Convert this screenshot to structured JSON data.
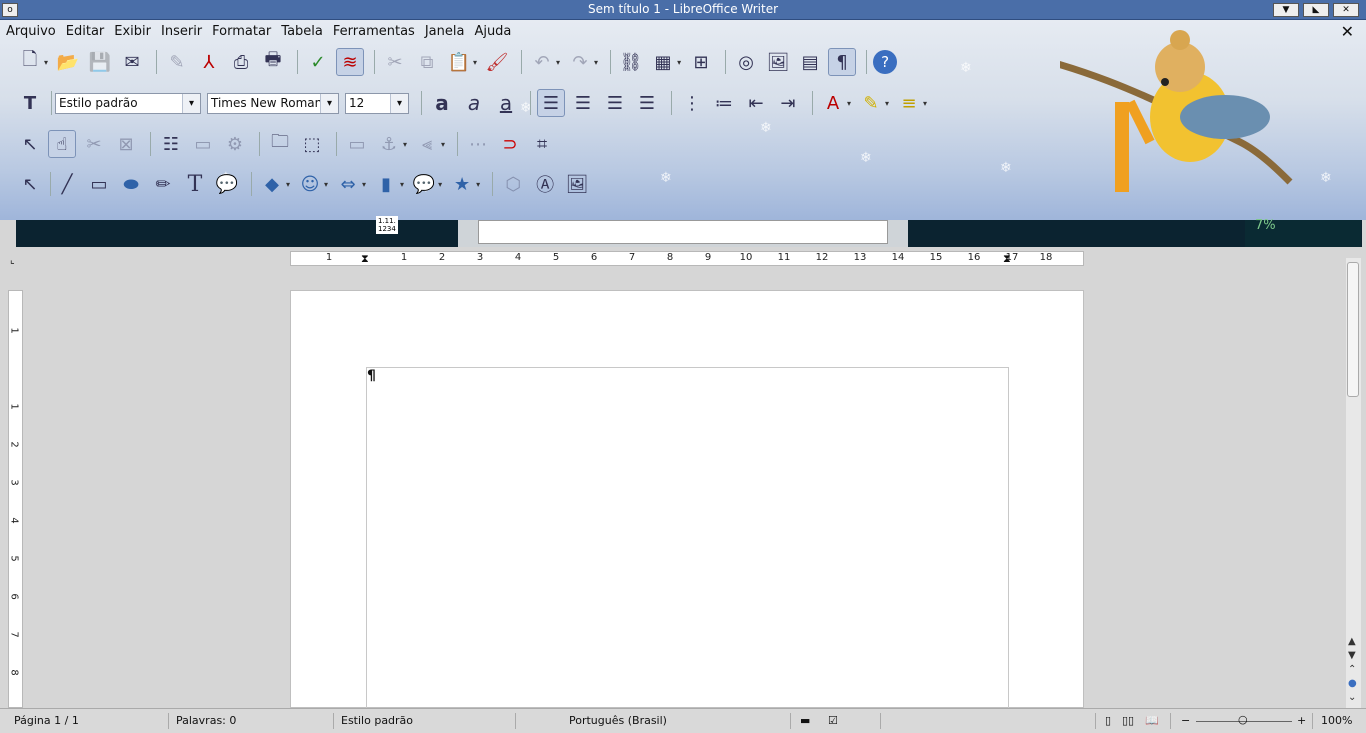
{
  "window": {
    "title": "Sem título 1 - LibreOffice Writer"
  },
  "menu": [
    "Arquivo",
    "Editar",
    "Exibir",
    "Inserir",
    "Formatar",
    "Tabela",
    "Ferramentas",
    "Janela",
    "Ajuda"
  ],
  "formatting": {
    "paragraph_style": "Estilo padrão",
    "font_name": "Times New Roman",
    "font_size": "12"
  },
  "ruler": {
    "h_ticks": [
      "1",
      "1",
      "2",
      "3",
      "4",
      "5",
      "6",
      "7",
      "8",
      "9",
      "10",
      "11",
      "12",
      "13",
      "14",
      "15",
      "16",
      "17",
      "18"
    ],
    "v_ticks": [
      "1",
      "1",
      "2",
      "3",
      "4",
      "5",
      "6",
      "7",
      "8"
    ]
  },
  "background_strip": {
    "percent": "7%",
    "stamp": "1.11. 1234"
  },
  "status": {
    "page": "Página 1 / 1",
    "words": "Palavras: 0",
    "style": "Estilo padrão",
    "language": "Português (Brasil)",
    "zoom": "100%"
  },
  "colors": {
    "title_bar": "#4a6ea8",
    "dark_strip": "#0b2330"
  }
}
